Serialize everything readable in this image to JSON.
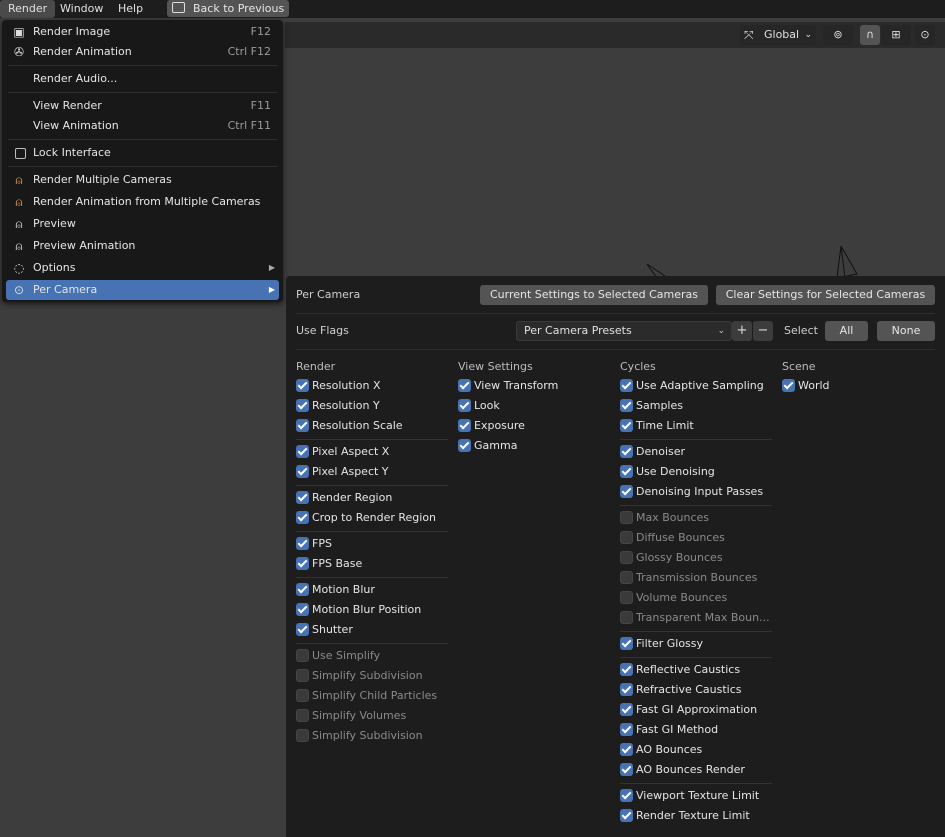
{
  "topbar": {
    "menus": [
      "Render",
      "Window",
      "Help"
    ],
    "back_button": "Back to Previous"
  },
  "header": {
    "orientation": "Global"
  },
  "menu": {
    "items": [
      {
        "label": "Render Image",
        "shortcut": "F12",
        "icon": "render-image-icon"
      },
      {
        "label": "Render Animation",
        "shortcut": "Ctrl F12",
        "icon": "render-animation-icon"
      },
      {
        "label": "Render Audio...",
        "shortcut": ""
      },
      {
        "label": "View Render",
        "shortcut": "F11"
      },
      {
        "label": "View Animation",
        "shortcut": "Ctrl F11"
      },
      {
        "label": "Lock Interface",
        "shortcut": ""
      },
      {
        "label": "Render Multiple Cameras",
        "shortcut": "",
        "icon": "camera-icon"
      },
      {
        "label": "Render Animation from Multiple Cameras",
        "shortcut": "",
        "icon": "camera-icon"
      },
      {
        "label": "Preview",
        "shortcut": "",
        "icon": "camera-icon"
      },
      {
        "label": "Preview Animation",
        "shortcut": "",
        "icon": "camera-icon"
      },
      {
        "label": "Options",
        "shortcut": "",
        "icon": "options-icon"
      },
      {
        "label": "Per Camera",
        "shortcut": "",
        "icon": "per-camera-icon"
      }
    ]
  },
  "panel": {
    "title": "Per Camera",
    "current_to_selected": "Current Settings to Selected Cameras",
    "clear_selected": "Clear Settings for Selected Cameras",
    "use_flags": "Use Flags",
    "presets": "Per Camera Presets",
    "select_label": "Select",
    "all": "All",
    "none": "None",
    "columns": [
      {
        "heading": "Render",
        "groups": [
          [
            {
              "label": "Resolution X",
              "checked": true
            },
            {
              "label": "Resolution Y",
              "checked": true
            },
            {
              "label": "Resolution Scale",
              "checked": true
            }
          ],
          [
            {
              "label": "Pixel Aspect X",
              "checked": true
            },
            {
              "label": "Pixel Aspect Y",
              "checked": true
            }
          ],
          [
            {
              "label": "Render Region",
              "checked": true
            },
            {
              "label": "Crop to Render Region",
              "checked": true
            }
          ],
          [
            {
              "label": "FPS",
              "checked": true
            },
            {
              "label": "FPS Base",
              "checked": true
            }
          ],
          [
            {
              "label": "Motion Blur",
              "checked": true
            },
            {
              "label": "Motion Blur Position",
              "checked": true
            },
            {
              "label": "Shutter",
              "checked": true
            }
          ],
          [
            {
              "label": "Use Simplify",
              "checked": false
            },
            {
              "label": "Simplify Subdivision",
              "checked": false
            },
            {
              "label": "Simplify Child Particles",
              "checked": false
            },
            {
              "label": "Simplify Volumes",
              "checked": false
            },
            {
              "label": "Simplify Subdivision",
              "checked": false
            }
          ]
        ]
      },
      {
        "heading": "View Settings",
        "groups": [
          [
            {
              "label": "View Transform",
              "checked": true
            },
            {
              "label": "Look",
              "checked": true
            },
            {
              "label": "Exposure",
              "checked": true
            },
            {
              "label": "Gamma",
              "checked": true
            }
          ]
        ]
      },
      {
        "heading": "Cycles",
        "groups": [
          [
            {
              "label": "Use Adaptive Sampling",
              "checked": true
            },
            {
              "label": "Samples",
              "checked": true
            },
            {
              "label": "Time Limit",
              "checked": true
            }
          ],
          [
            {
              "label": "Denoiser",
              "checked": true
            },
            {
              "label": "Use Denoising",
              "checked": true
            },
            {
              "label": "Denoising Input Passes",
              "checked": true
            }
          ],
          [
            {
              "label": "Max Bounces",
              "checked": false
            },
            {
              "label": "Diffuse Bounces",
              "checked": false
            },
            {
              "label": "Glossy Bounces",
              "checked": false
            },
            {
              "label": "Transmission Bounces",
              "checked": false
            },
            {
              "label": "Volume Bounces",
              "checked": false
            },
            {
              "label": "Transparent Max Boun...",
              "checked": false
            }
          ],
          [
            {
              "label": "Filter Glossy",
              "checked": true
            }
          ],
          [
            {
              "label": "Reflective Caustics",
              "checked": true
            },
            {
              "label": "Refractive Caustics",
              "checked": true
            },
            {
              "label": "Fast GI Approximation",
              "checked": true
            },
            {
              "label": "Fast GI Method",
              "checked": true
            },
            {
              "label": "AO Bounces",
              "checked": true
            },
            {
              "label": "AO Bounces Render",
              "checked": true
            }
          ],
          [
            {
              "label": "Viewport Texture Limit",
              "checked": true
            },
            {
              "label": "Render Texture Limit",
              "checked": true
            }
          ]
        ]
      },
      {
        "heading": "Scene",
        "groups": [
          [
            {
              "label": "World",
              "checked": true
            }
          ]
        ]
      }
    ]
  }
}
